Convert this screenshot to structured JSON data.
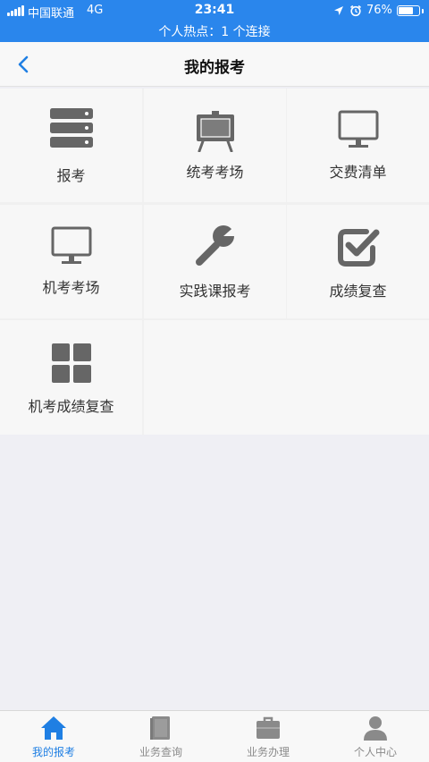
{
  "status_bar": {
    "carrier": "中国联通",
    "network": "4G",
    "time": "23:41",
    "battery_percent": "76%",
    "battery_level": 0.76,
    "hotspot_text": "个人热点：1 个连接",
    "icons": [
      "signal-icon",
      "location-icon",
      "alarm-icon",
      "battery-icon"
    ]
  },
  "nav": {
    "title": "我的报考",
    "back_icon": "chevron-left-icon"
  },
  "menu": {
    "items": [
      {
        "label": "报考",
        "icon": "server-stack-icon"
      },
      {
        "label": "统考考场",
        "icon": "easel-board-icon"
      },
      {
        "label": "交费清单",
        "icon": "monitor-icon"
      },
      {
        "label": "机考考场",
        "icon": "monitor-icon"
      },
      {
        "label": "实践课报考",
        "icon": "wrench-icon"
      },
      {
        "label": "成绩复查",
        "icon": "checkbox-icon"
      },
      {
        "label": "机考成绩复查",
        "icon": "grid-icon"
      }
    ]
  },
  "tabbar": {
    "items": [
      {
        "label": "我的报考",
        "icon": "home-icon",
        "active": true
      },
      {
        "label": "业务查询",
        "icon": "book-icon",
        "active": false
      },
      {
        "label": "业务办理",
        "icon": "briefcase-icon",
        "active": false
      },
      {
        "label": "个人中心",
        "icon": "person-icon",
        "active": false
      }
    ]
  },
  "colors": {
    "status_bar_bg": "#2a86ec",
    "accent": "#1f7fe3",
    "icon_gray": "#666666",
    "tab_inactive": "#8a8a8a"
  }
}
